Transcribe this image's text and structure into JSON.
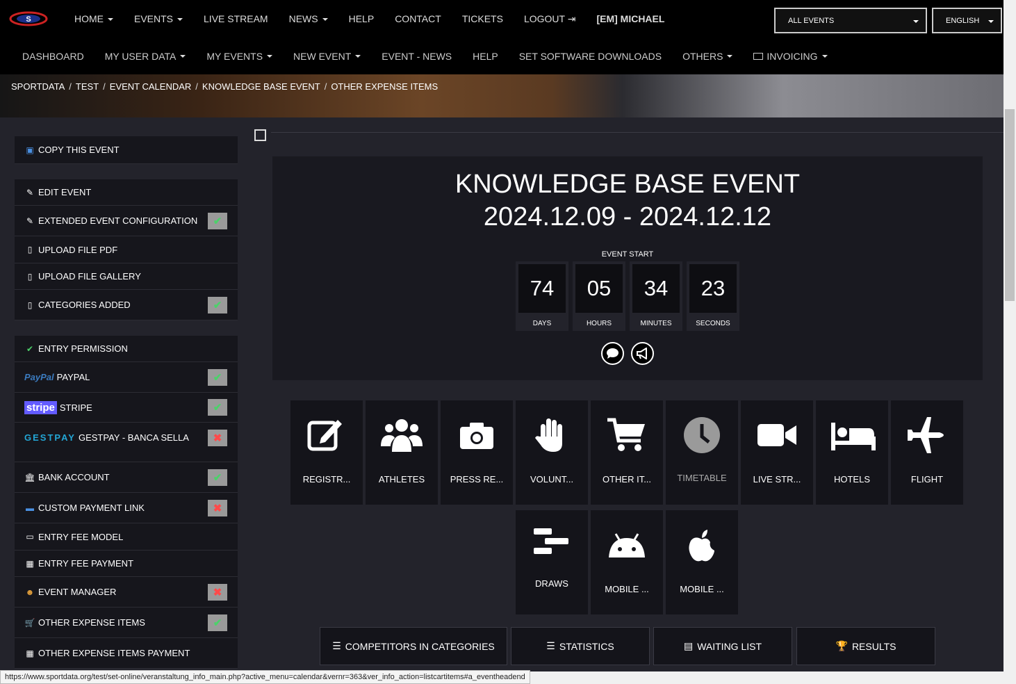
{
  "topnav": {
    "items": [
      {
        "label": "HOME",
        "caret": true
      },
      {
        "label": "EVENTS",
        "caret": true
      },
      {
        "label": "LIVE STREAM",
        "caret": false
      },
      {
        "label": "NEWS",
        "caret": true
      },
      {
        "label": "HELP",
        "caret": false
      },
      {
        "label": "CONTACT",
        "caret": false
      },
      {
        "label": "TICKETS",
        "caret": false
      },
      {
        "label": "LOGOUT",
        "caret": false
      },
      {
        "label": "[EM] MICHAEL",
        "caret": false
      }
    ],
    "events_select": "ALL EVENTS",
    "language_select": "ENGLISH"
  },
  "subnav": {
    "items": [
      "DASHBOARD",
      "MY USER DATA",
      "MY EVENTS",
      "NEW EVENT",
      "EVENT - NEWS",
      "HELP",
      "SET SOFTWARE DOWNLOADS",
      "OTHERS",
      "INVOICING"
    ]
  },
  "breadcrumb": [
    "SPORTDATA",
    "TEST",
    "EVENT CALENDAR",
    "KNOWLEDGE BASE EVENT",
    "OTHER EXPENSE ITEMS"
  ],
  "sidebar": {
    "copy_event": "COPY THIS EVENT",
    "edit_event": "EDIT EVENT",
    "extended_config": "EXTENDED EVENT CONFIGURATION",
    "upload_pdf": "UPLOAD FILE PDF",
    "upload_gallery": "UPLOAD FILE GALLERY",
    "categories_added": "CATEGORIES ADDED",
    "entry_permission": "ENTRY PERMISSION",
    "paypal": "PAYPAL",
    "paypal_logo": "PayPal",
    "stripe": "STRIPE",
    "stripe_logo": "stripe",
    "gestpay": "GESTPAY - BANCA SELLA",
    "gestpay_logo": "GESTPAY",
    "bank_account": "BANK ACCOUNT",
    "custom_payment": "CUSTOM PAYMENT LINK",
    "entry_fee_model": "ENTRY FEE MODEL",
    "entry_fee_payment": "ENTRY FEE PAYMENT",
    "event_manager": "EVENT MANAGER",
    "other_expense": "OTHER EXPENSE ITEMS",
    "other_expense_payment": "OTHER EXPENSE ITEMS PAYMENT",
    "status_ok": "✔",
    "status_no": "✖"
  },
  "event": {
    "title": "KNOWLEDGE BASE EVENT",
    "dates": "2024.12.09 - 2024.12.12",
    "start_label": "EVENT START",
    "countdown": {
      "days": "74",
      "days_label": "DAYS",
      "hours": "05",
      "hours_label": "HOURS",
      "minutes": "34",
      "minutes_label": "MINUTES",
      "seconds": "23",
      "seconds_label": "SECONDS"
    }
  },
  "tiles": [
    "REGISTR...",
    "ATHLETES",
    "PRESS RE...",
    "VOLUNT...",
    "OTHER IT...",
    "TIMETABLE",
    "LIVE STR...",
    "HOTELS",
    "FLIGHT",
    "DRAWS",
    "MOBILE ...",
    "MOBILE ..."
  ],
  "buttons": {
    "competitors": "COMPETITORS IN CATEGORIES",
    "statistics": "STATISTICS",
    "waiting_list": "WAITING LIST",
    "results": "RESULTS"
  },
  "status_url": "https://www.sportdata.org/test/set-online/veranstaltung_info_main.php?active_menu=calendar&vernr=363&ver_info_action=listcartitems#a_eventheadend",
  "colors": {
    "accent_ok": "#4cd16a",
    "accent_no": "#ff4a4a",
    "bg": "#23232b"
  }
}
